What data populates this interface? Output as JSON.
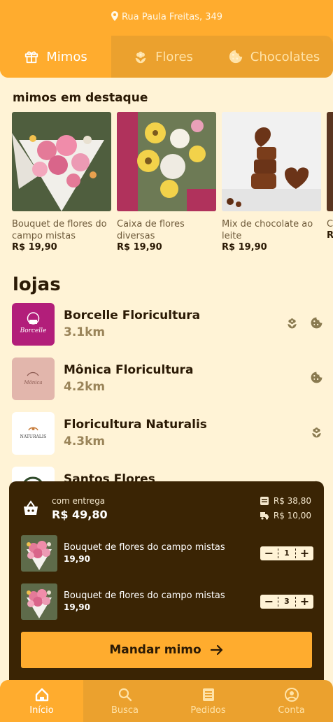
{
  "header": {
    "address": "Rua Paula Freitas, 349",
    "tabs": [
      {
        "label": "Mimos",
        "icon": "gift-icon",
        "active": true
      },
      {
        "label": "Flores",
        "icon": "flower-icon",
        "active": false
      },
      {
        "label": "Chocolates",
        "icon": "cookie-icon",
        "active": false
      }
    ]
  },
  "featured": {
    "title": "mimos em destaque",
    "items": [
      {
        "name": "Bouquet de flores do campo mistas",
        "price": "R$ 19,90"
      },
      {
        "name": "Caixa de flores diversas",
        "price": "R$ 19,90"
      },
      {
        "name": "Mix de chocolate ao leite",
        "price": "R$ 19,90"
      },
      {
        "name": "Ca fo",
        "price": "R$"
      }
    ]
  },
  "stores": {
    "title": "lojas",
    "items": [
      {
        "name": "Borcelle Floricultura",
        "distance": "3.1km",
        "logo_text": "Borcelle",
        "categories": [
          "flower-icon",
          "cookie-icon"
        ]
      },
      {
        "name": "Mônica Floricultura",
        "distance": "4.2km",
        "logo_text": "Mônica",
        "categories": [
          "cookie-icon"
        ]
      },
      {
        "name": "Floricultura Naturalis",
        "distance": "4.3km",
        "logo_text": "NATURALIS",
        "categories": [
          "flower-icon"
        ]
      },
      {
        "name": "Santos Flores",
        "distance": "",
        "logo_text": "",
        "categories": [
          "flower-icon",
          "cookie-icon"
        ]
      }
    ]
  },
  "cart": {
    "delivery_label": "com entrega",
    "total": "R$ 49,80",
    "subtotal": "R$ 38,80",
    "delivery_fee": "R$ 10,00",
    "items": [
      {
        "name": "Bouquet de flores do campo mistas",
        "price": "19,90",
        "quantity": "1"
      },
      {
        "name": "Bouquet de flores do campo mistas",
        "price": "19,90",
        "quantity": "3"
      }
    ],
    "send_label": "Mandar mimo"
  },
  "nav": [
    {
      "label": "Início",
      "icon": "home-icon",
      "active": true
    },
    {
      "label": "Busca",
      "icon": "search-icon",
      "active": false
    },
    {
      "label": "Pedidos",
      "icon": "receipt-icon",
      "active": false
    },
    {
      "label": "Conta",
      "icon": "user-icon",
      "active": false
    }
  ],
  "colors": {
    "primary": "#FFAC2E",
    "primary_dark": "#EBA12E",
    "background": "#FFF3D6",
    "cart_bg": "#3A2404",
    "text": "#2B1A05",
    "muted": "#9A8459",
    "icon_olive": "#8A7A50"
  }
}
